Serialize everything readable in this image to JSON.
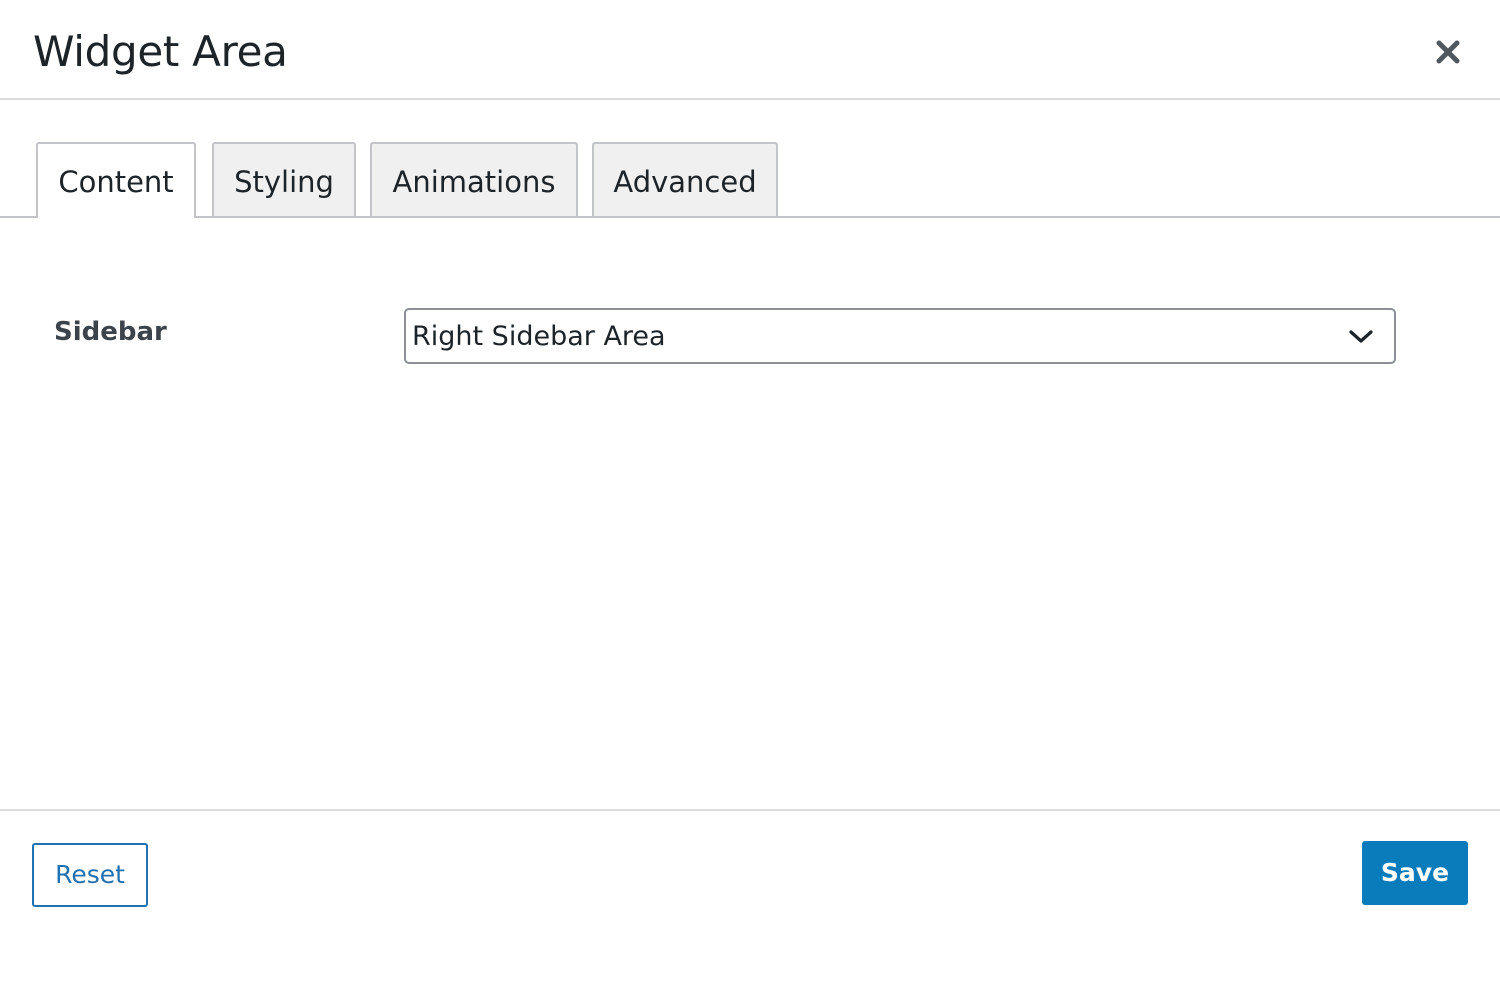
{
  "dialog": {
    "title": "Widget Area",
    "close_icon": "close-icon"
  },
  "tabs": [
    {
      "label": "Content",
      "active": true
    },
    {
      "label": "Styling",
      "active": false
    },
    {
      "label": "Animations",
      "active": false
    },
    {
      "label": "Advanced",
      "active": false
    }
  ],
  "content": {
    "sidebar_field": {
      "label": "Sidebar",
      "selected_value": "Right Sidebar Area",
      "icon": "chevron-down-icon"
    }
  },
  "footer": {
    "reset_label": "Reset",
    "save_label": "Save"
  },
  "colors": {
    "accent": "#2271b1",
    "save_button": "#0a7cbb",
    "text": "#1d2327",
    "border": "#c3c4c7",
    "tab_inactive_bg": "#f0f0f1"
  }
}
